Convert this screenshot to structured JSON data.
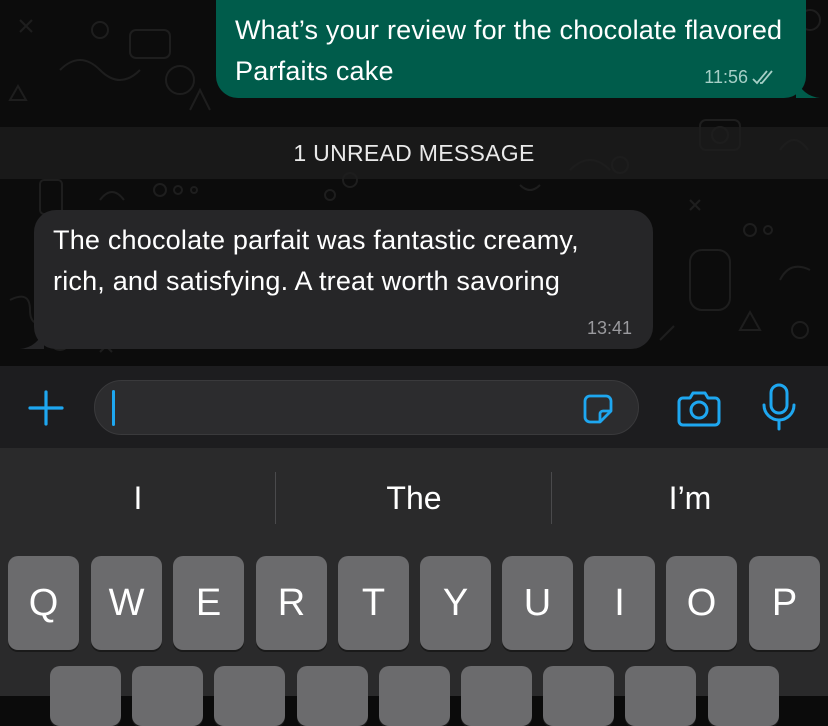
{
  "chat": {
    "outgoing": {
      "text": "What’s your review for the chocolate flavored Parfaits cake",
      "time": "11:56",
      "status_icon": "double-check-icon"
    },
    "unread_label": "1 UNREAD MESSAGE",
    "incoming": {
      "text": "The chocolate parfait was fantastic creamy, rich, and satisfying. A treat worth savoring",
      "time": "13:41"
    }
  },
  "composer": {
    "value": "",
    "icons": [
      "plus-icon",
      "sticker-icon",
      "camera-icon",
      "microphone-icon"
    ],
    "accent_color": "#1ea7f0"
  },
  "keyboard": {
    "suggestions": [
      "I",
      "The",
      "I’m"
    ],
    "row1": [
      "Q",
      "W",
      "E",
      "R",
      "T",
      "Y",
      "U",
      "I",
      "O",
      "P"
    ]
  },
  "colors": {
    "outgoing_bubble": "#005c4b",
    "incoming_bubble": "#262628",
    "background": "#0c0c0c"
  }
}
